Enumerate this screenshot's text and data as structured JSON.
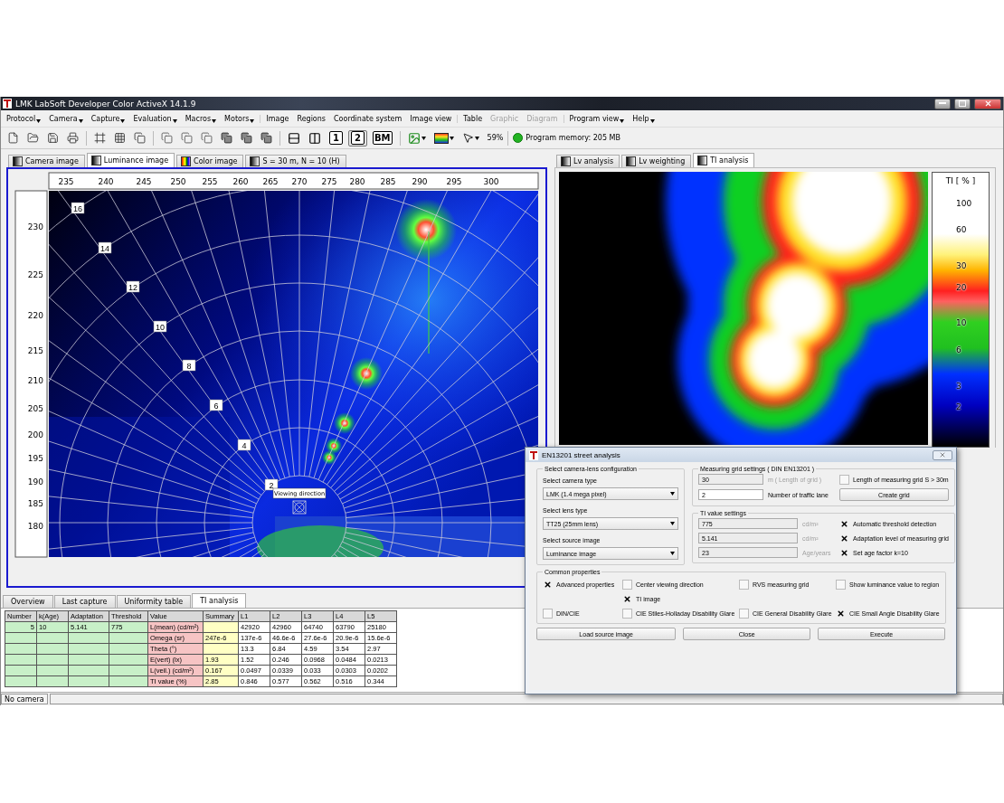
{
  "window": {
    "title": "LMK LabSoft Developer Color ActiveX  14.1.9"
  },
  "menu_groups": [
    {
      "items": [
        {
          "label": "Protocol",
          "submenu": true,
          "disabled": false
        },
        {
          "label": "Camera",
          "submenu": true,
          "disabled": false
        },
        {
          "label": "Capture",
          "submenu": true,
          "disabled": false
        },
        {
          "label": "Evaluation",
          "submenu": true,
          "disabled": false
        },
        {
          "label": "Macros",
          "submenu": true,
          "disabled": false
        },
        {
          "label": "Motors",
          "submenu": true,
          "disabled": false
        }
      ]
    },
    {
      "items": [
        {
          "label": "Image",
          "submenu": false,
          "disabled": false
        },
        {
          "label": "Regions",
          "submenu": false,
          "disabled": false
        },
        {
          "label": "Coordinate system",
          "submenu": false,
          "disabled": false
        },
        {
          "label": "Image view",
          "submenu": false,
          "disabled": false
        }
      ]
    },
    {
      "items": [
        {
          "label": "Table",
          "submenu": false,
          "disabled": false
        },
        {
          "label": "Graphic",
          "submenu": false,
          "disabled": true
        },
        {
          "label": "Diagram",
          "submenu": false,
          "disabled": true
        }
      ]
    },
    {
      "items": [
        {
          "label": "Program view",
          "submenu": true,
          "disabled": false
        },
        {
          "label": "Help",
          "submenu": true,
          "disabled": false
        }
      ]
    }
  ],
  "toolbar": {
    "view_buttons": [
      {
        "label": "1",
        "selected": false
      },
      {
        "label": "2",
        "selected": true
      },
      {
        "label": "BM",
        "selected": false
      }
    ],
    "zoom": "59%",
    "memory": "Program memory: 205 MB"
  },
  "image_tabs": [
    {
      "label": "Camera image",
      "selected": false
    },
    {
      "label": "Luminance image",
      "selected": true
    },
    {
      "label": "Color image",
      "selected": false
    },
    {
      "label": "S = 30 m, N = 10 (H)",
      "selected": false
    }
  ],
  "luminance_image": {
    "x_ticks": [
      "235",
      "240",
      "245",
      "250",
      "255",
      "260",
      "265",
      "270",
      "275",
      "280",
      "285",
      "290",
      "295",
      "300"
    ],
    "y_ticks": [
      "230",
      "225",
      "220",
      "215",
      "210",
      "205",
      "200",
      "195",
      "190",
      "185",
      "180"
    ],
    "markers": [
      "16",
      "14",
      "12",
      "10",
      "8",
      "6",
      "4",
      "2"
    ],
    "viewing_direction": "Viewing direction"
  },
  "analysis_tabs": [
    {
      "label": "Lv analysis",
      "selected": false
    },
    {
      "label": "Lv weighting",
      "selected": false
    },
    {
      "label": "TI analysis",
      "selected": true
    }
  ],
  "ti_legend": {
    "title": "TI [ % ]",
    "labels": [
      "100",
      "60",
      "30",
      "20",
      "10",
      "6",
      "3",
      "2"
    ]
  },
  "bottom_tabs": [
    {
      "label": "Overview",
      "selected": false
    },
    {
      "label": "Last capture",
      "selected": false
    },
    {
      "label": "Uniformity table",
      "selected": false
    },
    {
      "label": "TI analysis",
      "selected": true
    }
  ],
  "table": {
    "columns": [
      {
        "label": "Number",
        "color": "#c8f0c8"
      },
      {
        "label": "k(Age)",
        "color": "#c8f0c8"
      },
      {
        "label": "Adaptation",
        "color": "#c8f0c8"
      },
      {
        "label": "Threshold",
        "color": "#c8f0c8"
      },
      {
        "label": "Value",
        "color": "#f6c4c4"
      },
      {
        "label": "Summary",
        "color": "#ffffc4"
      },
      {
        "label": "L1",
        "color": "#ffffff"
      },
      {
        "label": "L2",
        "color": "#ffffff"
      },
      {
        "label": "L3",
        "color": "#ffffff"
      },
      {
        "label": "L4",
        "color": "#ffffff"
      },
      {
        "label": "L5",
        "color": "#ffffff"
      }
    ],
    "rows": [
      [
        "5",
        "10",
        "5.141",
        "775",
        "L(mean) (cd/m²)",
        null,
        "42920",
        "42960",
        "64740",
        "63790",
        "25180"
      ],
      [
        null,
        null,
        null,
        null,
        "Omega (sr)",
        "247e-6",
        "137e-6",
        "46.6e-6",
        "27.6e-6",
        "20.9e-6",
        "15.6e-6"
      ],
      [
        null,
        null,
        null,
        null,
        "Theta (°)",
        null,
        "13.3",
        "6.84",
        "4.59",
        "3.54",
        "2.97"
      ],
      [
        null,
        null,
        null,
        null,
        "E(vert) (lx)",
        "1.93",
        "1.52",
        "0.246",
        "0.0968",
        "0.0484",
        "0.0213"
      ],
      [
        null,
        null,
        null,
        null,
        "L(veil.) (cd/m²)",
        "0.167",
        "0.0497",
        "0.0339",
        "0.033",
        "0.0303",
        "0.0202"
      ],
      [
        null,
        null,
        null,
        null,
        "TI value (%)",
        "2.85",
        "0.846",
        "0.577",
        "0.562",
        "0.516",
        "0.344"
      ]
    ]
  },
  "status_bar": {
    "text": "No camera"
  },
  "dialog": {
    "title": "EN13201 street analysis",
    "camera_lens": {
      "title": "Select camera-lens configuration",
      "fields": [
        {
          "label": "Select camera type",
          "value": "LMK (1.4 mega pixel)"
        },
        {
          "label": "Select lens type",
          "value": "TT25 (25mm lens)"
        },
        {
          "label": "Select source image",
          "value": "Luminance image"
        }
      ]
    },
    "measuring_grid": {
      "title": "Measuring grid settings ( DIN EN13201 )",
      "length": {
        "value": "30",
        "disabled": true
      },
      "length_unit": "m ( Length of grid )",
      "long_grid": {
        "label": "Length of measuring grid S > 30m",
        "checked": false
      },
      "lanes": {
        "value": "2",
        "disabled": false
      },
      "lanes_label": "Number of traffic lane",
      "create_button": "Create grid"
    },
    "ti_settings": {
      "title": "TI value settings",
      "rows": [
        {
          "value": "775",
          "disabled": true,
          "unit": "cd/m²",
          "label": "Automatic threshold detection",
          "checked": true
        },
        {
          "value": "5.141",
          "disabled": true,
          "unit": "cd/m²",
          "label": "Adaptation level of measuring grid",
          "checked": true
        },
        {
          "value": "23",
          "disabled": true,
          "unit": "Age/years",
          "label": "Set age factor k=10",
          "checked": true
        }
      ]
    },
    "common": {
      "title": "Common properties",
      "rows": [
        [
          {
            "label": "Advanced properties",
            "checked": true
          },
          {
            "label": "Center viewing direction",
            "checked": false
          },
          {
            "label": "RVS measuring grid",
            "checked": false
          },
          {
            "label": "Show luminance value to region",
            "checked": false
          }
        ],
        [
          null,
          {
            "label": "TI image",
            "checked": true
          },
          null,
          null
        ],
        [
          {
            "label": "DIN/CIE",
            "checked": false
          },
          {
            "label": "CIE Stiles-Holladay Disability Glare",
            "checked": false
          },
          {
            "label": "CIE General Disability Glare",
            "checked": false
          },
          {
            "label": "CIE Small Angle Disability Glare",
            "checked": true
          }
        ]
      ]
    },
    "buttons": [
      "Load source image",
      "Close",
      "Execute"
    ]
  }
}
